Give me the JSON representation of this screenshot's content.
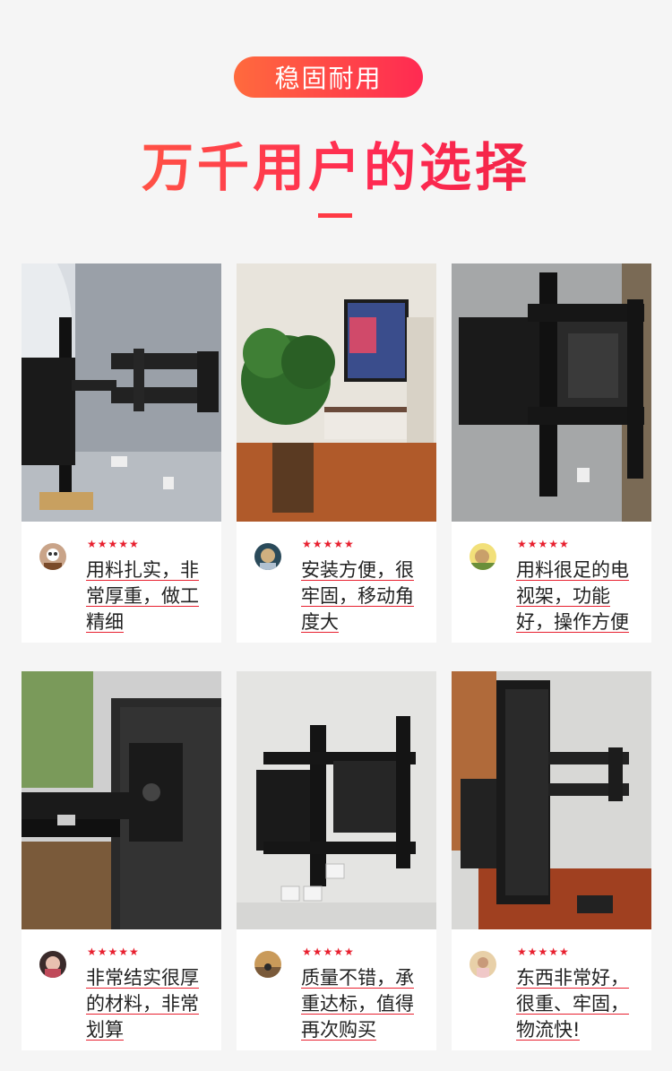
{
  "header": {
    "badge": "稳固耐用",
    "title": "万千用户的选择"
  },
  "colors": {
    "accent_start": "#ff6a3d",
    "accent_end": "#ff2a52",
    "star": "#e8202f"
  },
  "cards": [
    {
      "rating": "★★★★★",
      "review": "用料扎实，非常厚重，做工精细",
      "avatar": "user-avatar-icon"
    },
    {
      "rating": "★★★★★",
      "review": "安装方便，很牢固，移动角度大",
      "avatar": "user-avatar-icon"
    },
    {
      "rating": "★★★★★",
      "review": "用料很足的电视架，功能好，操作方便",
      "avatar": "user-avatar-icon"
    },
    {
      "rating": "★★★★★",
      "review": "非常结实很厚的材料，非常划算",
      "avatar": "user-avatar-icon"
    },
    {
      "rating": "★★★★★",
      "review": "质量不错，承重达标，值得再次购买",
      "avatar": "user-avatar-icon"
    },
    {
      "rating": "★★★★★",
      "review": "东西非常好，很重、牢固，物流快!",
      "avatar": "user-avatar-icon"
    }
  ]
}
